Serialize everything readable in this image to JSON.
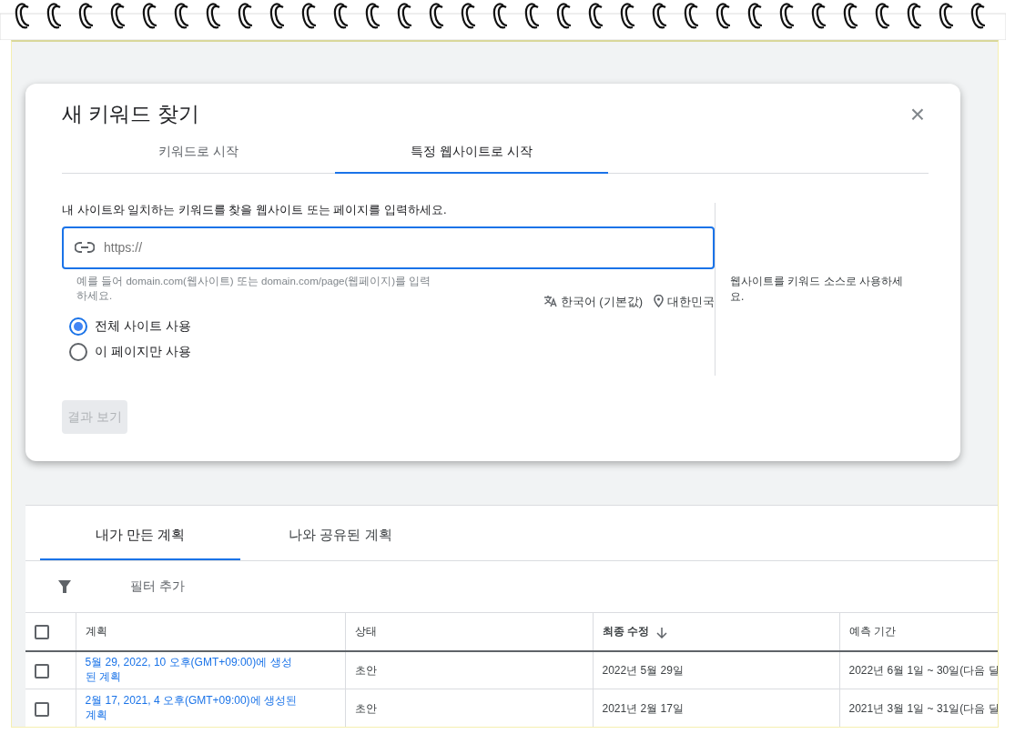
{
  "dialog": {
    "title": "새 키워드 찾기",
    "close": "×",
    "tabs": [
      {
        "label": "키워드로 시작",
        "selected": false
      },
      {
        "label": "특정 웹사이트로 시작",
        "selected": true
      }
    ],
    "prompt": "내 사이트와 일치하는 키워드를 찾을 웹사이트 또는 페이지를 입력하세요.",
    "url_field": {
      "placeholder": "https://",
      "focused": true
    },
    "hint": "예를 들어 domain.com(웹사이트) 또는 domain.com/page(웹페이지)를 입력하세요.",
    "language": "한국어 (기본값)",
    "location": "대한민국",
    "scope_options": [
      {
        "label": "전체 사이트 사용",
        "selected": true
      },
      {
        "label": "이 페이지만 사용",
        "selected": false
      }
    ],
    "submit": {
      "label": "결과 보기",
      "disabled": true
    },
    "side_note": "웹사이트를 키워드 소스로 사용하세요."
  },
  "plans": {
    "tabs": [
      {
        "label": "내가 만든 계획",
        "selected": true
      },
      {
        "label": "나와 공유된 계획",
        "selected": false
      }
    ],
    "filter_label": "필터 추가",
    "table": {
      "select_all_checked": false,
      "columns": [
        {
          "label": "계획",
          "sorted": false
        },
        {
          "label": "상태",
          "sorted": false
        },
        {
          "label": "최종 수정",
          "sorted": true
        },
        {
          "label": "예측 기간",
          "sorted": false
        }
      ],
      "rows": [
        {
          "checked": false,
          "cells": [
            "5월 29, 2022, 10 오후(GMT+09:00)에 생성된 계획",
            "초안",
            "2022년 5월 29일",
            "2022년 6월 1일 ~ 30일(다음 달"
          ]
        },
        {
          "checked": false,
          "cells": [
            "2월 17, 2021, 4 오후(GMT+09:00)에 생성된 계획",
            "초안",
            "2021년 2월 17일",
            "2021년 3월 1일 ~ 31일(다음 달"
          ]
        }
      ]
    }
  }
}
